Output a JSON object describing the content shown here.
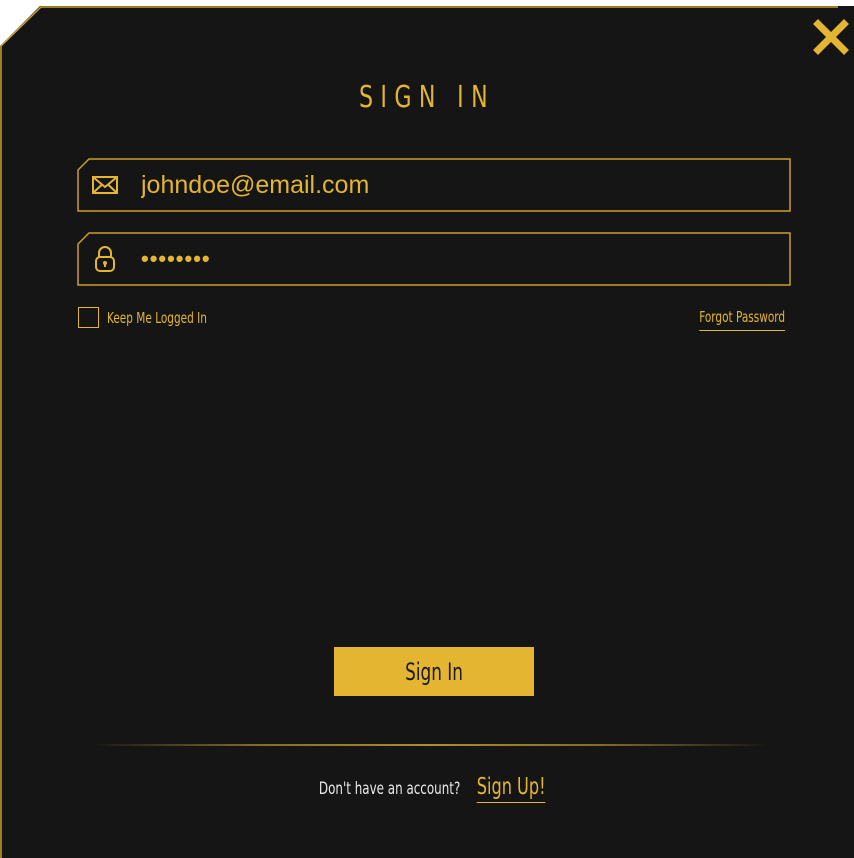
{
  "dialog": {
    "title": "SIGN IN",
    "close_icon": "close-icon"
  },
  "email_field": {
    "icon": "envelope-icon",
    "value": "johndoe@email.com"
  },
  "password_field": {
    "icon": "lock-icon",
    "value": "••••••••"
  },
  "options": {
    "remember_label": "Keep Me Logged In",
    "remember_checked": false,
    "forgot_label": "Forgot Password"
  },
  "actions": {
    "signin_label": "Sign In"
  },
  "footer": {
    "question": "Don't have an account?",
    "signup_label": "Sign Up!"
  },
  "colors": {
    "background": "#151515",
    "accent": "#e3b531",
    "footer_text": "#e8e8e8"
  }
}
